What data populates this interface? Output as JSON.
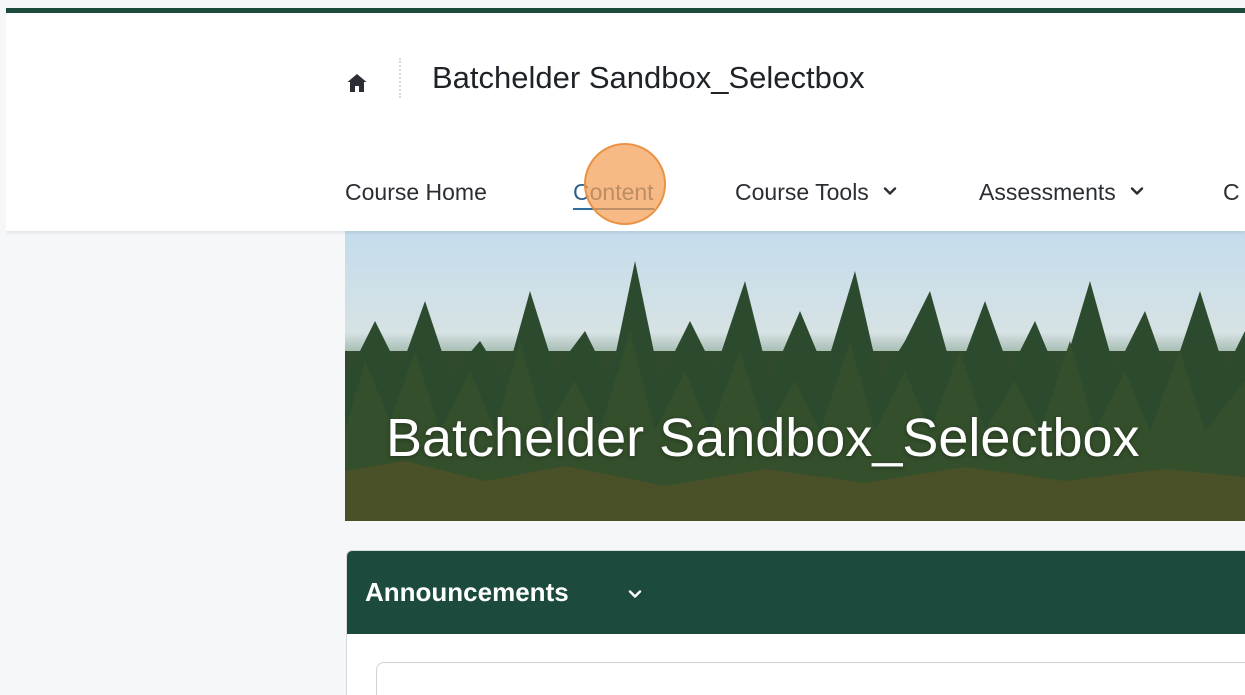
{
  "header": {
    "home_icon": "home-icon",
    "course_title": "Batchelder Sandbox_Selectbox"
  },
  "nav": {
    "items": [
      {
        "label": "Course Home",
        "active": false,
        "has_dropdown": false
      },
      {
        "label": "Content",
        "active": true,
        "has_dropdown": false
      },
      {
        "label": "Course Tools",
        "active": false,
        "has_dropdown": true
      },
      {
        "label": "Assessments",
        "active": false,
        "has_dropdown": true
      },
      {
        "label": "C",
        "active": false,
        "has_dropdown": false
      }
    ],
    "dropdown_icon": "chevron-down-icon"
  },
  "banner": {
    "title": "Batchelder Sandbox_Selectbox"
  },
  "announcements": {
    "title": "Announcements",
    "toggle_icon": "chevron-down-icon"
  },
  "colors": {
    "accent_dark_green": "#1c4a3d",
    "active_link": "#2e5f87",
    "click_indicator": "#f4a054"
  }
}
